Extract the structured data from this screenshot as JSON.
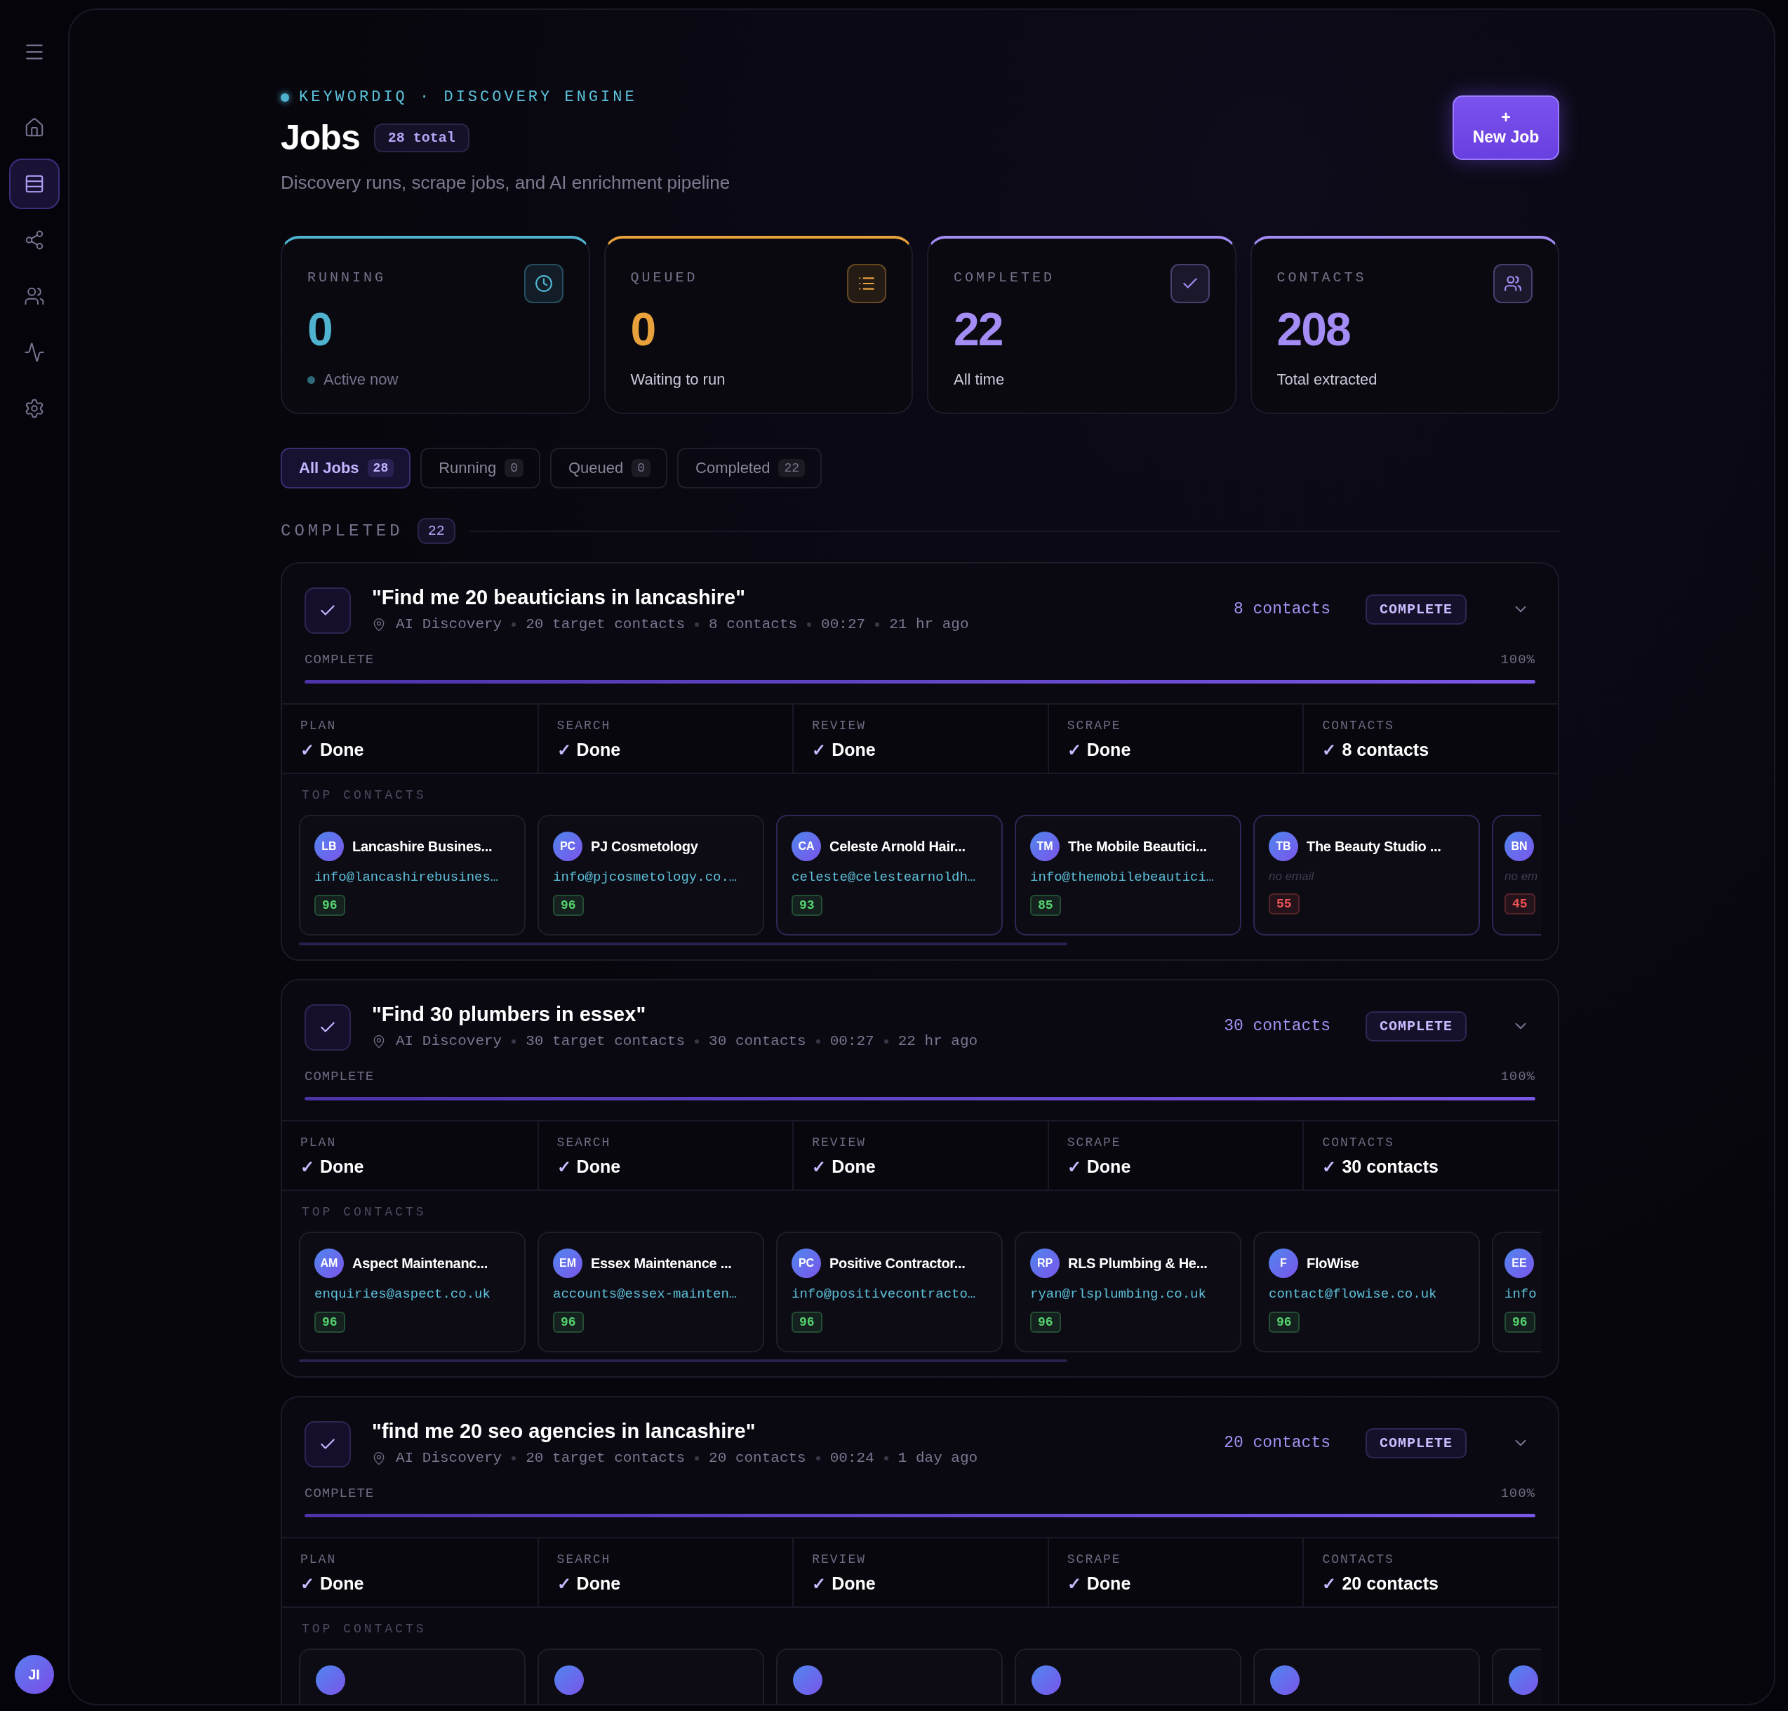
{
  "sidebar": {
    "items": [
      {
        "kind": "home",
        "selected": false
      },
      {
        "kind": "jobs",
        "selected": true
      },
      {
        "kind": "flow",
        "selected": false
      },
      {
        "kind": "people",
        "selected": false
      },
      {
        "kind": "activity",
        "selected": false
      },
      {
        "kind": "settings",
        "selected": false
      }
    ],
    "avatar": "JI"
  },
  "header": {
    "eyebrow": "KEYWORDIQ · DISCOVERY ENGINE",
    "title": "Jobs",
    "total": "28 total",
    "subtitle": "Discovery runs, scrape jobs, and AI enrichment pipeline",
    "new_job": {
      "icon": "+",
      "label": "New Job"
    }
  },
  "stats": [
    {
      "label": "RUNNING",
      "value": "0",
      "note": "Active now",
      "dot": true,
      "kind": "clock",
      "color": "#4fb3cf"
    },
    {
      "label": "QUEUED",
      "value": "0",
      "note": "Waiting to run",
      "dot": false,
      "kind": "list",
      "color": "#e9a23b"
    },
    {
      "label": "COMPLETED",
      "value": "22",
      "note": "All time",
      "dot": false,
      "kind": "check",
      "color": "#a48cf5"
    },
    {
      "label": "CONTACTS",
      "value": "208",
      "note": "Total extracted",
      "dot": false,
      "kind": "users",
      "color": "#a48cf5"
    }
  ],
  "tabs": [
    {
      "label": "All Jobs",
      "count": "28",
      "selected": true
    },
    {
      "label": "Running",
      "count": "0",
      "selected": false
    },
    {
      "label": "Queued",
      "count": "0",
      "selected": false
    },
    {
      "label": "Completed",
      "count": "22",
      "selected": false
    }
  ],
  "section": {
    "title": "COMPLETED",
    "count": "22"
  },
  "jobs": [
    {
      "title": "\"Find me 20 beauticians in lancashire\"",
      "meta": [
        "AI Discovery",
        "20 target contacts",
        "8 contacts",
        "00:27",
        "21 hr ago"
      ],
      "contacts_count": "8 contacts",
      "status": "COMPLETE",
      "progress": {
        "label": "COMPLETE",
        "percent": "100%",
        "level": 1
      },
      "stages": [
        {
          "label": "PLAN",
          "mark": "✓",
          "value": "Done"
        },
        {
          "label": "SEARCH",
          "mark": "✓",
          "value": "Done"
        },
        {
          "label": "REVIEW",
          "mark": "✓",
          "value": "Done"
        },
        {
          "label": "SCRAPE",
          "mark": "✓",
          "value": "Done"
        },
        {
          "label": "CONTACTS",
          "mark": "✓",
          "value": "8 contacts"
        }
      ],
      "top_label": "TOP CONTACTS",
      "contacts": [
        {
          "kind": "full",
          "initials": "LB",
          "name": "Lancashire Busines...",
          "email": "info@lancashirebusines…",
          "has_email": true,
          "score": "96",
          "color": "#56d36f",
          "highlighted": false
        },
        {
          "kind": "full",
          "initials": "PC",
          "name": "PJ Cosmetology",
          "email": "info@pjcosmetology.co.…",
          "has_email": true,
          "score": "96",
          "color": "#56d36f",
          "highlighted": false
        },
        {
          "kind": "full",
          "initials": "CA",
          "name": "Celeste Arnold Hair...",
          "email": "celeste@celestearnoldh…",
          "has_email": true,
          "score": "93",
          "color": "#56d36f",
          "highlighted": true
        },
        {
          "kind": "full",
          "initials": "TM",
          "name": "The Mobile Beautici...",
          "email": "info@themobilebeautici…",
          "has_email": true,
          "score": "85",
          "color": "#56d36f",
          "highlighted": true
        },
        {
          "kind": "full",
          "initials": "TB",
          "name": "The Beauty Studio ...",
          "email": "no email",
          "has_email": false,
          "score": "55",
          "color": "#ef5454",
          "highlighted": true
        },
        {
          "kind": "partial",
          "initials": "BN",
          "email": "no em",
          "has_email": false,
          "score": "45",
          "color": "#ef5454",
          "highlighted": true
        }
      ]
    },
    {
      "title": "\"Find 30 plumbers in essex\"",
      "meta": [
        "AI Discovery",
        "30 target contacts",
        "30 contacts",
        "00:27",
        "22 hr ago"
      ],
      "contacts_count": "30 contacts",
      "status": "COMPLETE",
      "progress": {
        "label": "COMPLETE",
        "percent": "100%",
        "level": 1
      },
      "stages": [
        {
          "label": "PLAN",
          "mark": "✓",
          "value": "Done"
        },
        {
          "label": "SEARCH",
          "mark": "✓",
          "value": "Done"
        },
        {
          "label": "REVIEW",
          "mark": "✓",
          "value": "Done"
        },
        {
          "label": "SCRAPE",
          "mark": "✓",
          "value": "Done"
        },
        {
          "label": "CONTACTS",
          "mark": "✓",
          "value": "30 contacts"
        }
      ],
      "top_label": "TOP CONTACTS",
      "contacts": [
        {
          "kind": "full",
          "initials": "AM",
          "name": "Aspect Maintenanc...",
          "email": "enquiries@aspect.co.uk",
          "has_email": true,
          "score": "96",
          "color": "#56d36f",
          "highlighted": false
        },
        {
          "kind": "full",
          "initials": "EM",
          "name": "Essex Maintenance ...",
          "email": "accounts@essex-mainten…",
          "has_email": true,
          "score": "96",
          "color": "#56d36f",
          "highlighted": false
        },
        {
          "kind": "full",
          "initials": "PC",
          "name": "Positive Contractor...",
          "email": "info@positivecontracto…",
          "has_email": true,
          "score": "96",
          "color": "#56d36f",
          "highlighted": false
        },
        {
          "kind": "full",
          "initials": "RP",
          "name": "RLS Plumbing & He...",
          "email": "ryan@rlsplumbing.co.uk",
          "has_email": true,
          "score": "96",
          "color": "#56d36f",
          "highlighted": false
        },
        {
          "kind": "full",
          "initials": "F",
          "name": "FloWise",
          "email": "contact@flowise.co.uk",
          "has_email": true,
          "score": "96",
          "color": "#56d36f",
          "highlighted": false
        },
        {
          "kind": "partial",
          "initials": "EE",
          "email": "info",
          "has_email": true,
          "score": "96",
          "color": "#56d36f",
          "highlighted": false
        }
      ]
    },
    {
      "title": "\"find me 20 seo agencies in lancashire\"",
      "meta": [
        "AI Discovery",
        "20 target contacts",
        "20 contacts",
        "00:24",
        "1 day ago"
      ],
      "contacts_count": "20 contacts",
      "status": "COMPLETE",
      "progress": {
        "label": "COMPLETE",
        "percent": "100%",
        "level": 1
      },
      "stages": [
        {
          "label": "PLAN",
          "mark": "✓",
          "value": "Done"
        },
        {
          "label": "SEARCH",
          "mark": "✓",
          "value": "Done"
        },
        {
          "label": "REVIEW",
          "mark": "✓",
          "value": "Done"
        },
        {
          "label": "SCRAPE",
          "mark": "✓",
          "value": "Done"
        },
        {
          "label": "CONTACTS",
          "mark": "✓",
          "value": "20 contacts"
        }
      ],
      "top_label": "TOP CONTACTS",
      "contacts": [
        {
          "kind": "cut"
        },
        {
          "kind": "cut"
        },
        {
          "kind": "cut"
        },
        {
          "kind": "cut"
        },
        {
          "kind": "cut"
        },
        {
          "kind": "cut"
        }
      ]
    }
  ]
}
